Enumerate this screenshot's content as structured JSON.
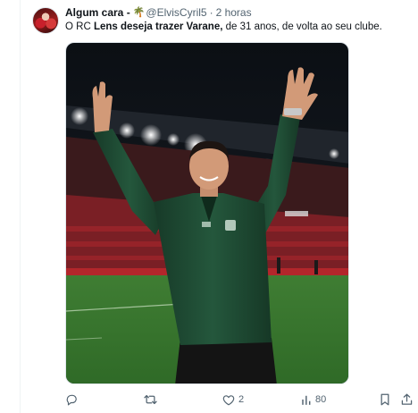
{
  "tweet": {
    "display_name": "Algum cara -",
    "name_emoji": "🌴",
    "handle": "@ElvisCyril5",
    "separator": "·",
    "time": "2 horas",
    "text": {
      "prefix": "O RC ",
      "bold": "Lens deseja trazer Varane,",
      "suffix": " de 31 anos, de volta ao seu clube."
    }
  },
  "actions": {
    "reply_icon": "reply-icon",
    "retweet_icon": "retweet-icon",
    "like_icon": "heart-icon",
    "like_count": "2",
    "views_icon": "views-icon",
    "views_count": "80",
    "bookmark_icon": "bookmark-icon",
    "share_icon": "share-icon"
  },
  "colors": {
    "muted": "#536471",
    "text": "#0f1419",
    "pitch": "#3b7a2e",
    "jacket": "#1f4a33"
  }
}
